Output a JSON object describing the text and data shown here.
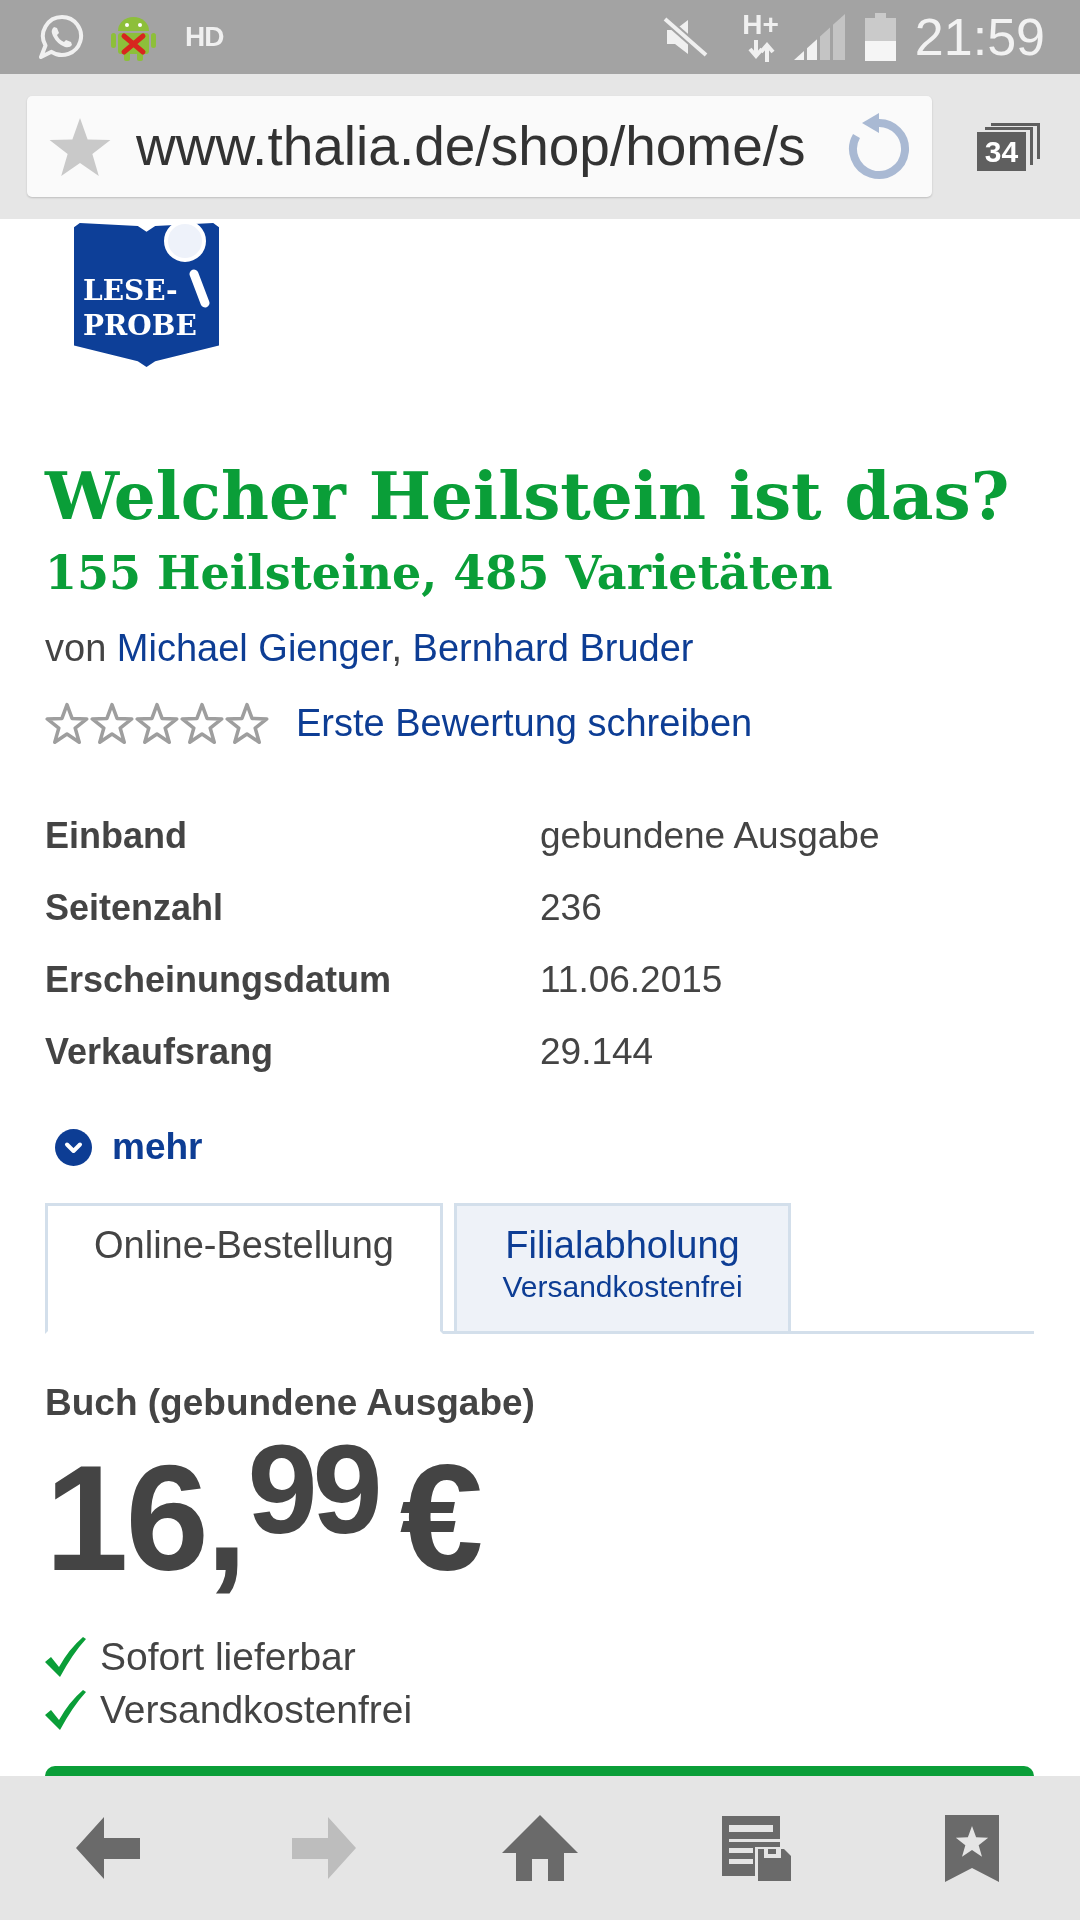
{
  "status_bar": {
    "hd_label": "HD",
    "network_type": "H+",
    "time": "21:59"
  },
  "browser": {
    "url": "www.thalia.de/shop/home/s",
    "tab_count": "34"
  },
  "badge": {
    "lines": [
      "LESE-",
      "PROBE"
    ]
  },
  "title": "Welcher Heilstein ist das?",
  "subtitle": "155 Heilsteine, 485 Varietäten",
  "byline": {
    "prefix": "von",
    "authors": [
      "Michael Gienger",
      "Bernhard Bruder"
    ],
    "separator": ", "
  },
  "rating": {
    "stars": 0,
    "link": "Erste Bewertung schreiben"
  },
  "details": [
    {
      "label": "Einband",
      "value": "gebundene Ausgabe"
    },
    {
      "label": "Seitenzahl",
      "value": "236"
    },
    {
      "label": "Erscheinungsdatum",
      "value": "11.06.2015"
    },
    {
      "label": "Verkaufsrang",
      "value": "29.144"
    }
  ],
  "more_link": {
    "label": "mehr",
    "expanded": false
  },
  "order_tabs": [
    {
      "label": "Online-Bestellung",
      "selected": true
    },
    {
      "label": "Filialabholung",
      "sublabel": "Versandkostenfrei",
      "selected": false
    }
  ],
  "offer": {
    "format": "Buch (gebundene Ausgabe)",
    "price": {
      "amount": "16,",
      "cents": "99",
      "currency": "€"
    },
    "features": [
      "Sofort lieferbar",
      "Versandkostenfrei"
    ]
  },
  "bottom_nav": [
    {
      "kind": "back",
      "disabled": false
    },
    {
      "kind": "forward",
      "disabled": true
    },
    {
      "kind": "home",
      "disabled": false
    },
    {
      "kind": "saved-pages",
      "disabled": false
    },
    {
      "kind": "bookmarks",
      "disabled": false
    }
  ]
}
